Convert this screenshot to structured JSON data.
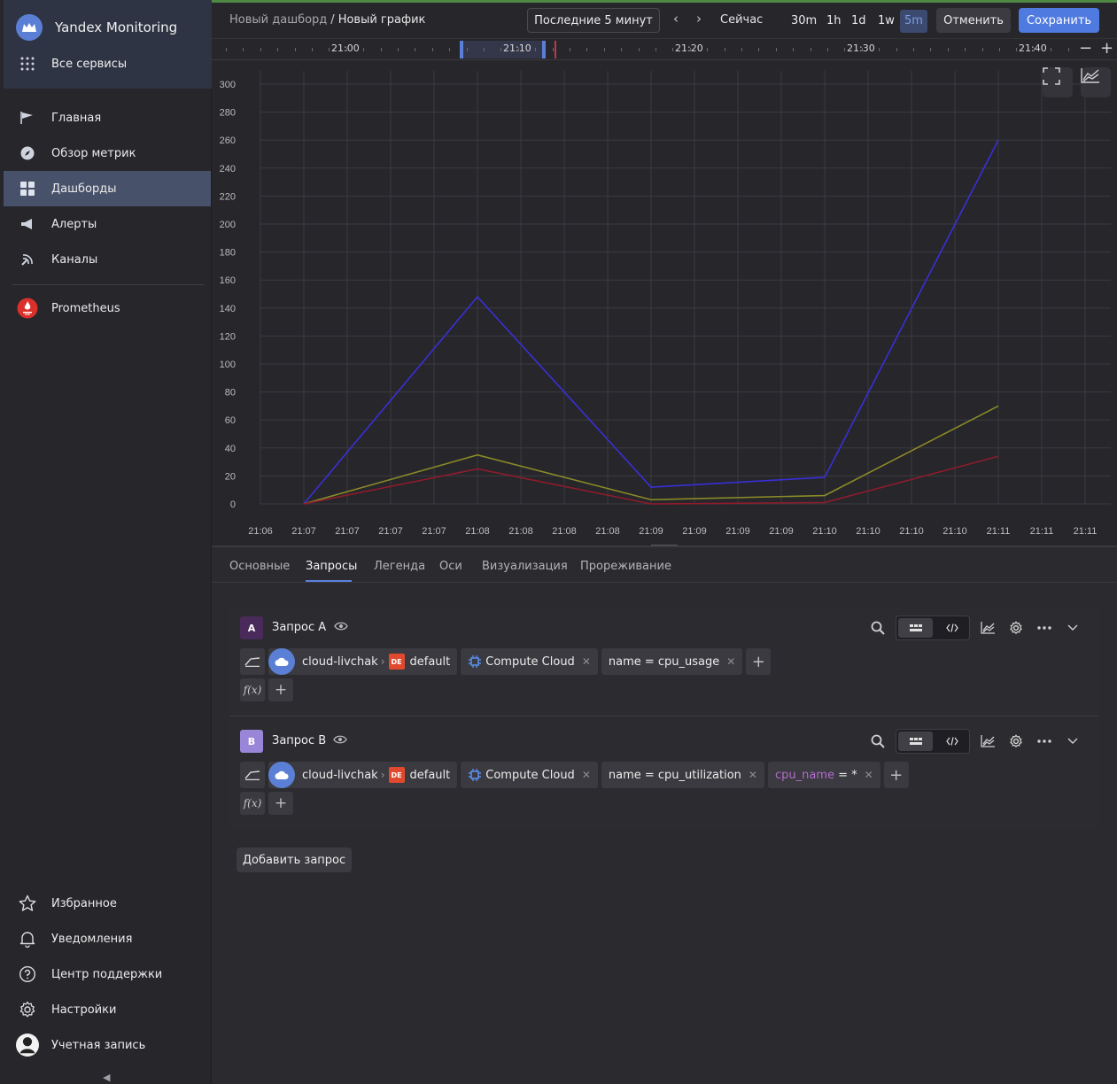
{
  "app": {
    "name": "Yandex Monitoring",
    "all_services": "Все сервисы"
  },
  "sidebar": {
    "items": [
      {
        "label": "Главная",
        "icon": "flag-icon"
      },
      {
        "label": "Обзор метрик",
        "icon": "compass-icon"
      },
      {
        "label": "Дашборды",
        "icon": "dashboard-icon",
        "active": true
      },
      {
        "label": "Алерты",
        "icon": "megaphone-icon"
      },
      {
        "label": "Каналы",
        "icon": "channel-icon"
      },
      {
        "label": "Prometheus",
        "icon": "prometheus-icon"
      }
    ],
    "bottom": [
      {
        "label": "Избранное",
        "icon": "star-icon"
      },
      {
        "label": "Уведомления",
        "icon": "bell-icon"
      },
      {
        "label": "Центр поддержки",
        "icon": "help-icon"
      },
      {
        "label": "Настройки",
        "icon": "gear-icon"
      },
      {
        "label": "Учетная запись",
        "icon": "avatar-icon"
      }
    ],
    "collapse_glyph": "◀"
  },
  "header": {
    "breadcrumb_parent": "Новый дашборд",
    "breadcrumb_sep": "/",
    "breadcrumb_current": "Новый график",
    "range": "Последние 5 минут",
    "prev": "‹",
    "next": "›",
    "now": "Сейчас",
    "zooms": [
      "30m",
      "1h",
      "1d",
      "1w",
      "5m"
    ],
    "active_zoom": "5m",
    "cancel": "Отменить",
    "save": "Сохранить"
  },
  "timeline": {
    "labels": [
      "21:00",
      "21:10",
      "21:20",
      "21:30",
      "21:40"
    ],
    "minus": "−",
    "plus": "+"
  },
  "chart_data": {
    "type": "line",
    "x": [
      "21:06",
      "21:07",
      "21:07",
      "21:07",
      "21:07",
      "21:08",
      "21:08",
      "21:08",
      "21:08",
      "21:09",
      "21:09",
      "21:09",
      "21:09",
      "21:10",
      "21:10",
      "21:10",
      "21:10",
      "21:11",
      "21:11",
      "21:11"
    ],
    "yticks": [
      0,
      20,
      40,
      60,
      80,
      100,
      120,
      140,
      160,
      180,
      200,
      220,
      240,
      260,
      280,
      300
    ],
    "ylim": [
      0,
      300
    ],
    "grid": true,
    "series": [
      {
        "color": "#3a2fd6",
        "points": [
          [
            1,
            0
          ],
          [
            5,
            148
          ],
          [
            9,
            12
          ],
          [
            13,
            19
          ],
          [
            17,
            260
          ]
        ]
      },
      {
        "color": "#8a8a28",
        "points": [
          [
            1,
            0
          ],
          [
            5,
            35
          ],
          [
            9,
            3
          ],
          [
            13,
            6
          ],
          [
            17,
            70
          ]
        ]
      },
      {
        "color": "#8e1c2c",
        "points": [
          [
            1,
            0
          ],
          [
            5,
            25
          ],
          [
            9,
            0
          ],
          [
            13,
            1
          ],
          [
            17,
            34
          ]
        ]
      }
    ]
  },
  "tabs": [
    "Основные",
    "Запросы",
    "Легенда",
    "Оси",
    "Визуализация",
    "Прореживание"
  ],
  "active_tab": "Запросы",
  "queries": [
    {
      "letter": "A",
      "title": "Запрос A",
      "color": "#4a2a5a",
      "cloud": "cloud-livchak",
      "folder_badge": "DE",
      "folder": "default",
      "service": "Compute Cloud",
      "filters": [
        "name = cpu_usage"
      ],
      "extra": null,
      "fx": "f(x)"
    },
    {
      "letter": "B",
      "title": "Запрос B",
      "color": "#9a86d8",
      "cloud": "cloud-livchak",
      "folder_badge": "DE",
      "folder": "default",
      "service": "Compute Cloud",
      "filters": [
        "name = cpu_utilization"
      ],
      "extra": {
        "key": "cpu_name",
        "op": " = *"
      },
      "fx": "f(x)"
    }
  ],
  "add_query": "Добавить запрос"
}
